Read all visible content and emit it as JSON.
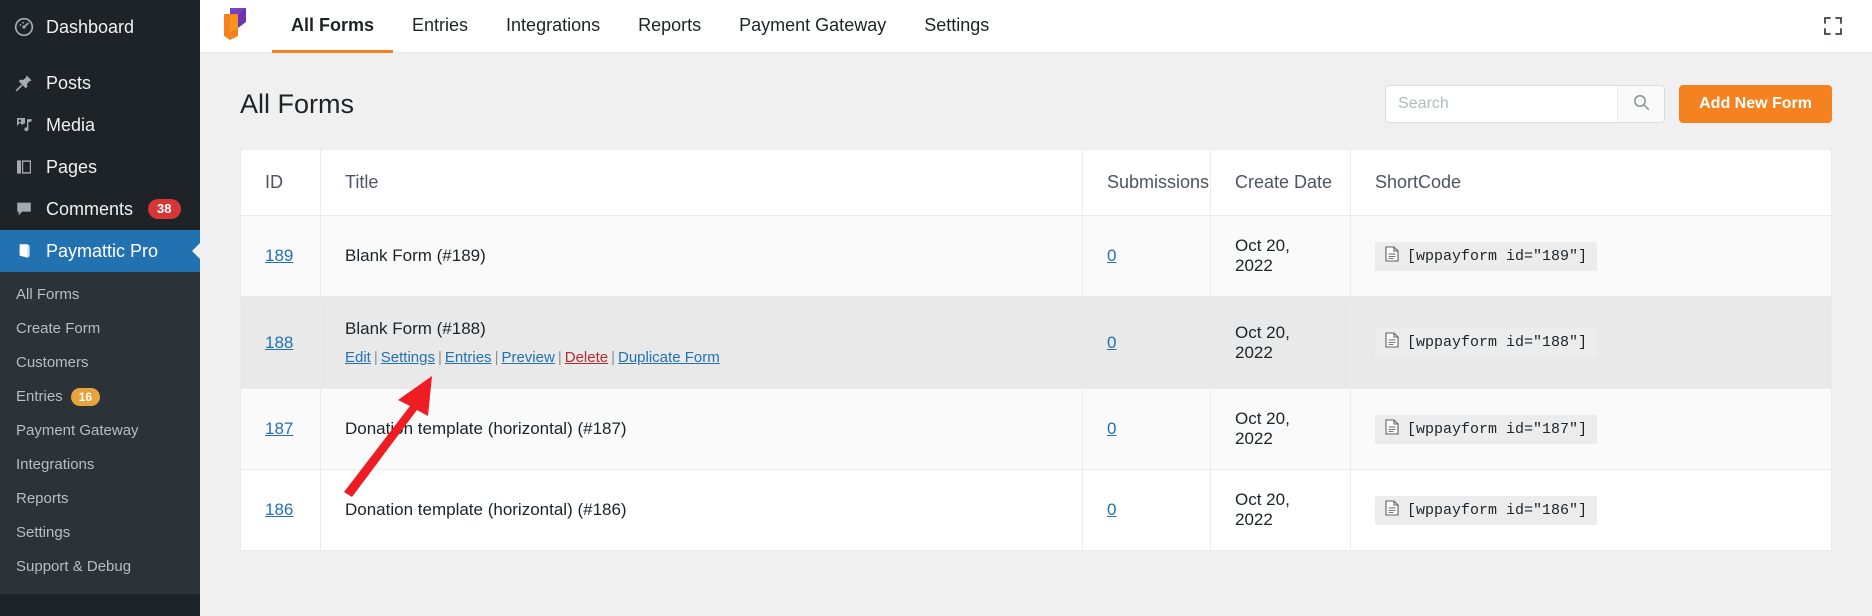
{
  "wp_sidebar": {
    "items": [
      {
        "label": "Dashboard",
        "icon": "dashboard-icon",
        "badge": null
      },
      {
        "label": "Posts",
        "icon": "pin-icon",
        "badge": null
      },
      {
        "label": "Media",
        "icon": "media-icon",
        "badge": null
      },
      {
        "label": "Pages",
        "icon": "pages-icon",
        "badge": null
      },
      {
        "label": "Comments",
        "icon": "comment-icon",
        "badge": "38"
      },
      {
        "label": "Paymattic Pro",
        "icon": "paymattic-icon",
        "badge": null
      }
    ],
    "submenu": [
      {
        "label": "All Forms",
        "badge": null
      },
      {
        "label": "Create Form",
        "badge": null
      },
      {
        "label": "Customers",
        "badge": null
      },
      {
        "label": "Entries",
        "badge": "16"
      },
      {
        "label": "Payment Gateway",
        "badge": null
      },
      {
        "label": "Integrations",
        "badge": null
      },
      {
        "label": "Reports",
        "badge": null
      },
      {
        "label": "Settings",
        "badge": null
      },
      {
        "label": "Support & Debug",
        "badge": null
      }
    ],
    "colors": {
      "background": "#1d2327",
      "submenu_background": "#2c3338",
      "active": "#2271b1",
      "comment_badge": "#d63638",
      "entries_badge": "#e8a33d"
    }
  },
  "topbar": {
    "logo": "paymattic-logo-icon",
    "tabs": [
      {
        "label": "All Forms",
        "active": true
      },
      {
        "label": "Entries",
        "active": false
      },
      {
        "label": "Integrations",
        "active": false
      },
      {
        "label": "Reports",
        "active": false
      },
      {
        "label": "Payment Gateway",
        "active": false
      },
      {
        "label": "Settings",
        "active": false
      }
    ],
    "expand_icon": "fullscreen-expand-icon",
    "active_underline_color": "#f58220"
  },
  "page": {
    "title": "All Forms"
  },
  "search": {
    "placeholder": "Search",
    "value": "",
    "icon": "search-icon"
  },
  "add_button": {
    "label": "Add New Form",
    "color": "#f58220"
  },
  "table": {
    "columns": [
      "ID",
      "Title",
      "Submissions",
      "Create Date",
      "ShortCode"
    ],
    "rows": [
      {
        "id": "189",
        "title": "Blank Form (#189)",
        "submissions": "0",
        "create_date": "Oct 20, 2022",
        "shortcode": "[wppayform id=\"189\"]",
        "hovered": false,
        "actions": []
      },
      {
        "id": "188",
        "title": "Blank Form (#188)",
        "submissions": "0",
        "create_date": "Oct 20, 2022",
        "shortcode": "[wppayform id=\"188\"]",
        "hovered": true,
        "actions": [
          {
            "label": "Edit",
            "danger": false
          },
          {
            "label": "Settings",
            "danger": false
          },
          {
            "label": "Entries",
            "danger": false
          },
          {
            "label": "Preview",
            "danger": false
          },
          {
            "label": "Delete",
            "danger": true
          },
          {
            "label": "Duplicate Form",
            "danger": false
          }
        ]
      },
      {
        "id": "187",
        "title": "Donation template (horizontal) (#187)",
        "submissions": "0",
        "create_date": "Oct 20, 2022",
        "shortcode": "[wppayform id=\"187\"]",
        "hovered": false,
        "actions": []
      },
      {
        "id": "186",
        "title": "Donation template (horizontal) (#186)",
        "submissions": "0",
        "create_date": "Oct 20, 2022",
        "shortcode": "[wppayform id=\"186\"]",
        "hovered": false,
        "actions": []
      }
    ]
  },
  "annotation": {
    "type": "red-arrow",
    "color": "#ee1d23",
    "points_to": "Settings"
  }
}
